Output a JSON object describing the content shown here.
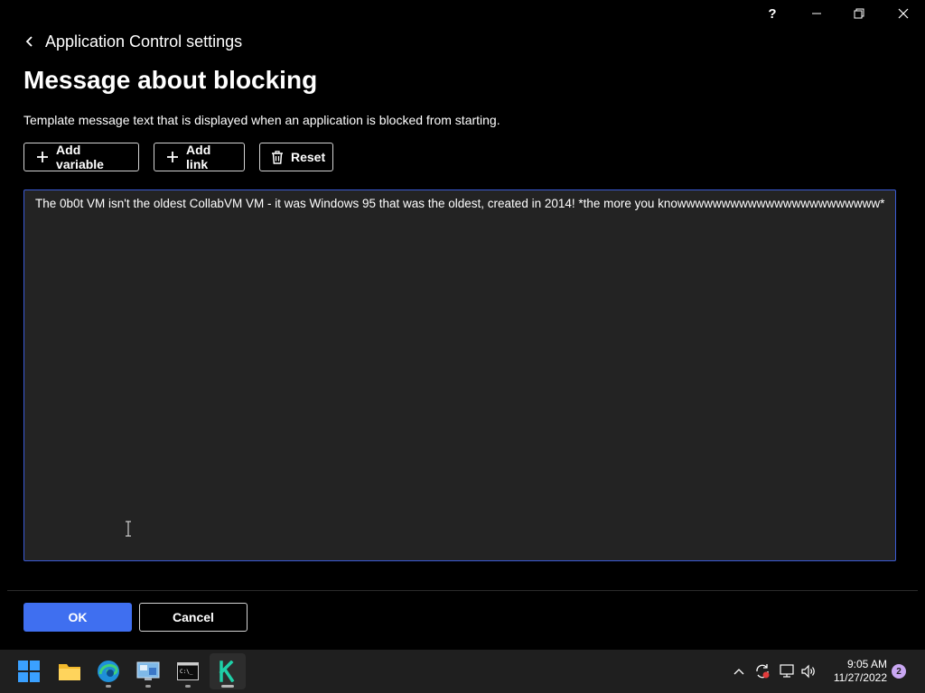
{
  "titlebar": {
    "help_label": "?",
    "minimize_icon": "minimize-icon",
    "maximize_icon": "restore-icon",
    "close_icon": "close-icon"
  },
  "breadcrumb": {
    "label": "Application Control settings"
  },
  "page": {
    "title": "Message about blocking",
    "description": "Template message text that is displayed when an application is blocked from starting."
  },
  "toolbar": {
    "add_variable": "Add variable",
    "add_link": "Add link",
    "reset": "Reset"
  },
  "message": {
    "value": "The 0b0t VM isn't the oldest CollabVM VM - it was Windows 95 that was the oldest, created in 2014! *the more you knowwwwwwwwwwwwwwwwwwwwwww*"
  },
  "footer": {
    "ok": "OK",
    "cancel": "Cancel"
  },
  "taskbar": {
    "apps": [
      {
        "name": "start-icon"
      },
      {
        "name": "file-explorer-icon"
      },
      {
        "name": "edge-icon"
      },
      {
        "name": "control-panel-icon"
      },
      {
        "name": "terminal-icon"
      },
      {
        "name": "kaspersky-icon"
      }
    ],
    "time": "9:05 AM",
    "date": "11/27/2022",
    "notification_count": "2"
  },
  "colors": {
    "accent": "#3f6ff0",
    "textarea_border": "#3b5bd6",
    "background": "#000000"
  }
}
